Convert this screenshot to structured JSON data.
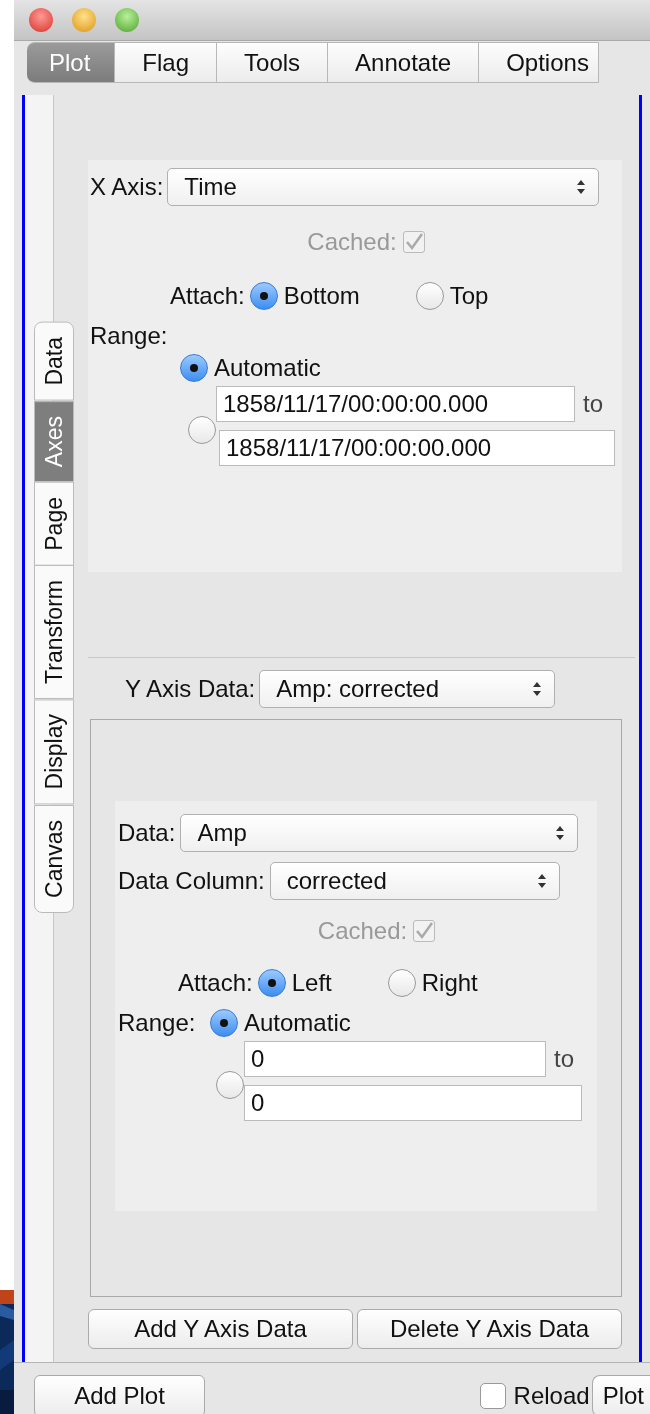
{
  "tabs": [
    {
      "label": "Plot",
      "selected": true
    },
    {
      "label": "Flag",
      "selected": false
    },
    {
      "label": "Tools",
      "selected": false
    },
    {
      "label": "Annotate",
      "selected": false
    },
    {
      "label": "Options",
      "selected": false
    }
  ],
  "side_tabs": [
    {
      "label": "Data",
      "selected": false
    },
    {
      "label": "Axes",
      "selected": true
    },
    {
      "label": "Page",
      "selected": false
    },
    {
      "label": "Transform",
      "selected": false
    },
    {
      "label": "Display",
      "selected": false
    },
    {
      "label": "Canvas",
      "selected": false
    }
  ],
  "x_axis": {
    "label": "X Axis:",
    "value": "Time",
    "cached": {
      "label": "Cached:",
      "checked": true,
      "disabled": true
    },
    "attach_label": "Attach:",
    "attach": [
      {
        "label": "Bottom",
        "selected": true
      },
      {
        "label": "Top",
        "selected": false
      }
    ],
    "range_label": "Range:",
    "range": [
      {
        "kind": "automatic",
        "label": "Automatic",
        "selected": true
      },
      {
        "kind": "custom",
        "selected": false,
        "from": "1858/11/17/00:00:00.000",
        "to_label": "to",
        "to": "1858/11/17/00:00:00.000"
      }
    ]
  },
  "y_axis_data": {
    "label": "Y Axis Data:",
    "value": "Amp: corrected"
  },
  "y_axis": {
    "data_label": "Data:",
    "data_value": "Amp",
    "column_label": "Data Column:",
    "column_value": "corrected",
    "cached": {
      "label": "Cached:",
      "checked": true,
      "disabled": true
    },
    "attach_label": "Attach:",
    "attach": [
      {
        "label": "Left",
        "selected": true
      },
      {
        "label": "Right",
        "selected": false
      }
    ],
    "range_label": "Range:",
    "range": [
      {
        "kind": "automatic",
        "label": "Automatic",
        "selected": true
      },
      {
        "kind": "custom",
        "selected": false,
        "from": "0",
        "to_label": "to",
        "to": "0"
      }
    ]
  },
  "axis_buttons": [
    "Add Y Axis Data",
    "Delete Y Axis Data"
  ],
  "bottom": {
    "add_plot": "Add Plot",
    "reload": {
      "label": "Reload",
      "checked": false
    },
    "plot": "Plot"
  }
}
